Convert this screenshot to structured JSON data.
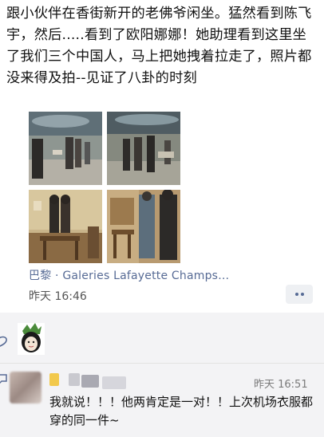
{
  "post": {
    "text": "跟小伙伴在香街新开的老佛爷闲坐。猛然看到陈飞宇，然后.....看到了欧阳娜娜！她助理看到这里坐了我们三个中国人，马上把她拽着拉走了，照片都没来得及拍--见证了八卦的时刻",
    "photos": [
      {
        "label": "photo-1"
      },
      {
        "label": "photo-2"
      },
      {
        "label": "photo-3"
      },
      {
        "label": "photo-4"
      }
    ],
    "location": "巴黎 · Galeries Lafayette Champs…",
    "timestamp": "昨天 16:46"
  },
  "comment": {
    "time": "昨天 16:51",
    "text": "我就说！！！他两肯定是一对！！上次机场衣服都穿的同一件~"
  },
  "colors": {
    "link": "#576b95",
    "interaction_bg": "#f3f3f5"
  },
  "icons": {
    "like": "heart-outline-icon",
    "comment": "comment-bubble-icon",
    "more": "more-dots-icon"
  }
}
